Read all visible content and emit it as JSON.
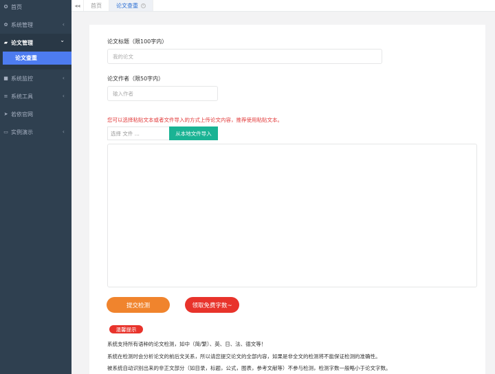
{
  "sidebar": {
    "items": [
      {
        "label": "首页",
        "icon": "home-icon",
        "glyph": "✪"
      },
      {
        "label": "系统管理",
        "icon": "gear-icon",
        "glyph": "✿",
        "chevron": "‹"
      },
      {
        "label": "论文管理",
        "icon": "bank-icon",
        "glyph": "▰",
        "chevron": "⌄"
      },
      {
        "label": "系统监控",
        "icon": "video-icon",
        "glyph": "■",
        "chevron": "‹"
      },
      {
        "label": "系统工具",
        "icon": "bars-icon",
        "glyph": "≡",
        "chevron": "‹"
      },
      {
        "label": "若依官网",
        "icon": "send-icon",
        "glyph": "➤"
      },
      {
        "label": "实例演示",
        "icon": "desktop-icon",
        "glyph": "▭",
        "chevron": "‹"
      }
    ],
    "sub_item": "论文查重"
  },
  "topbar": {
    "back_glyph": "◂◂",
    "tabs": [
      {
        "label": "首页"
      },
      {
        "label": "论文查重",
        "close": "×"
      }
    ]
  },
  "form": {
    "title_label": "论文标题（限100字内）",
    "title_placeholder": "我的论文",
    "author_label": "论文作者（限50字内）",
    "author_placeholder": "输入作者",
    "notice": "您可以选择粘贴文本或者文件导入的方式上传论文内容，推荐使用粘贴文本。",
    "file_placeholder": "选择 文件 ...",
    "file_button": "从本地文件导入",
    "submit_button": "提交检测",
    "free_button": "领取免费字数~"
  },
  "tips": {
    "badge": "温馨提示",
    "lines": [
      "系统支持所有语种的论文检测，如中（简/繁）、英、日、法、德文等！",
      "系统在检测时会分析论文的前后文关系，所以请您提交论文的全部内容，如果是非全文的检测将不能保证检测的准确性。",
      "被系统自动识别出来的非正文部分（如目录，标题，公式，图表，参考文献等）不参与检测，检测字数一般略小于论文字数。"
    ]
  },
  "colors": {
    "sidebar_bg": "#2f4050",
    "sub_active": "#4d7cf0",
    "import_btn": "#1ab394",
    "submit_btn": "#f0842d",
    "free_btn": "#e8332b",
    "notice_text": "#e23b3b"
  }
}
